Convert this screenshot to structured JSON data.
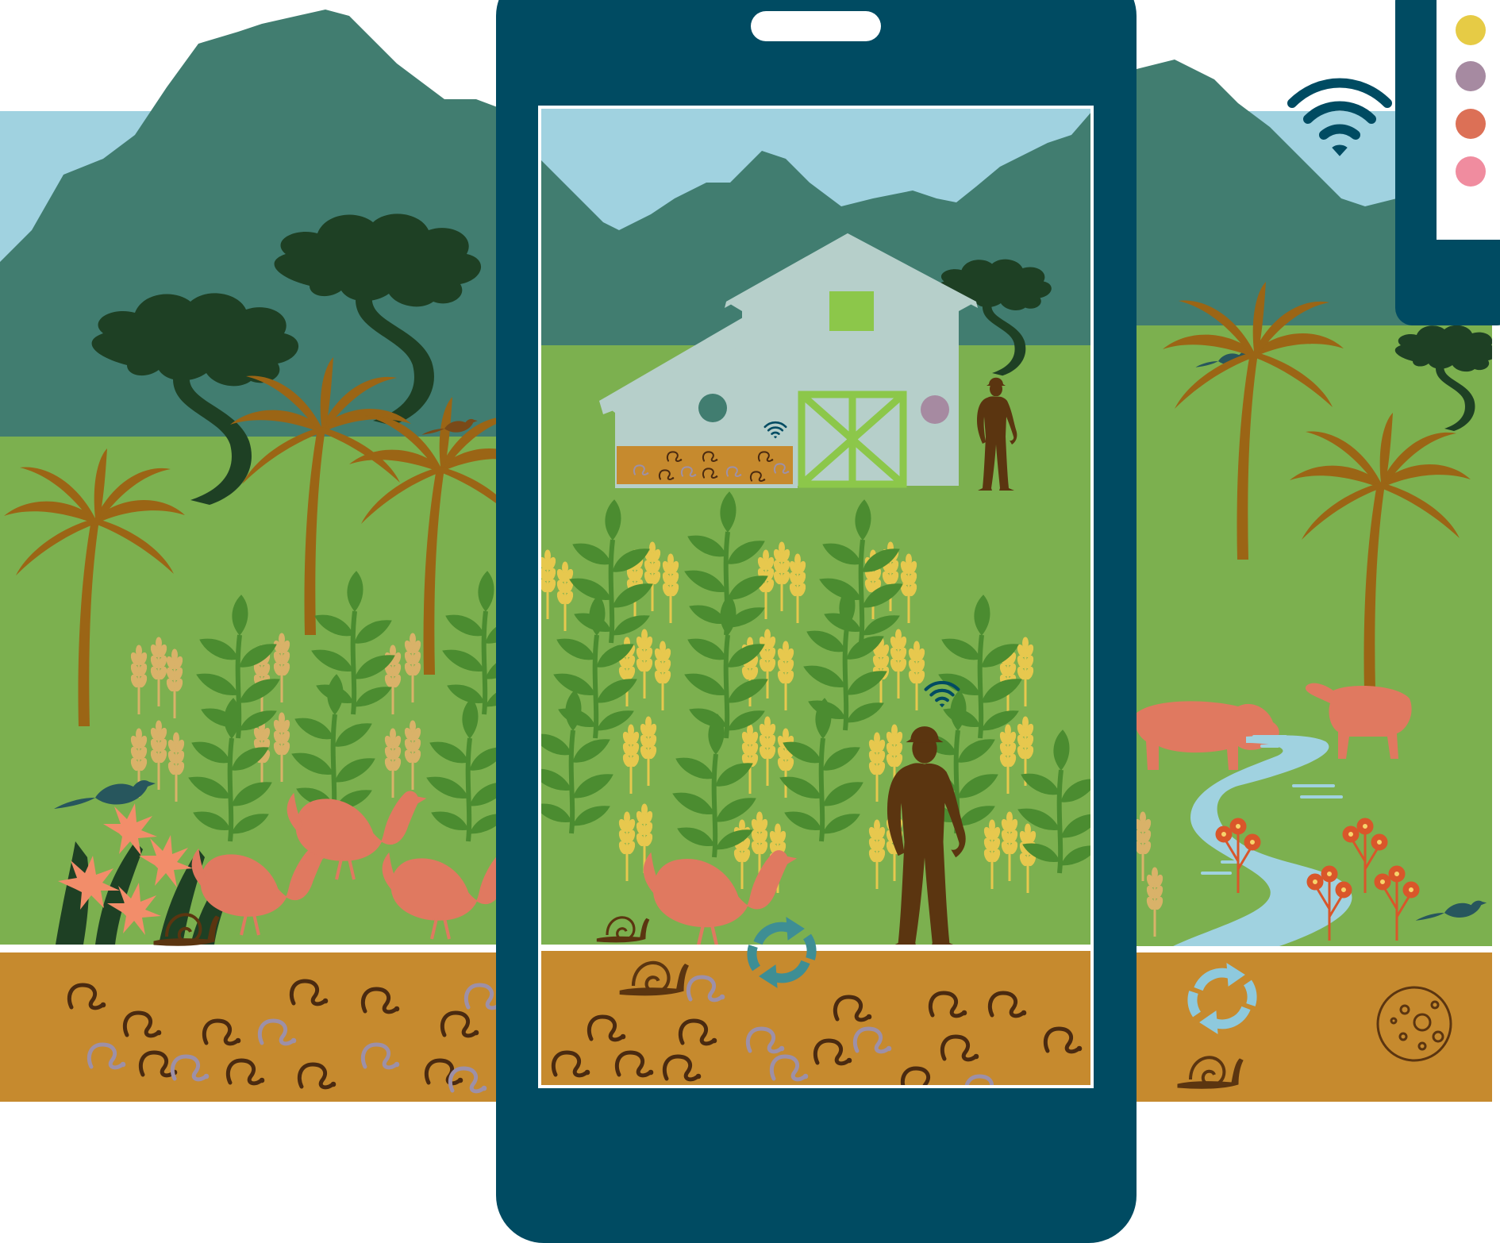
{
  "colors": {
    "sky": "#a0d2e0",
    "mountain": "#417d70",
    "grass": "#7cb04f",
    "soil": "#c68a2e",
    "worm_dark": "#4a2a10",
    "worm_light": "#9d90a8",
    "device": "#004b62",
    "pine": "#1e4024",
    "palm": "#9b6515",
    "leaf_green": "#4b8c30",
    "wheat": "#e7c84e",
    "wheat_pale": "#d9b269",
    "animal": "#e07960",
    "person": "#5b3510",
    "barn_wall": "#b6cfca",
    "barn_trim": "#8cc74a",
    "stream": "#a0d2e0",
    "bird": "#27565d",
    "flower_orange": "#d9562a",
    "lily": "#f28d6a",
    "recycle_teal": "#3e8e94",
    "recycle_light": "#8ec9dd",
    "dot_yellow": "#e6cb45",
    "dot_mauve": "#a68aa1",
    "dot_coral": "#dc7056",
    "dot_pink": "#f08c9f"
  },
  "icons": {
    "phone": "smartphone-icon",
    "tablet": "tablet-icon",
    "wifi": "wifi-icon",
    "recycle": "recycle-icon",
    "microbe": "microbe-icon"
  }
}
